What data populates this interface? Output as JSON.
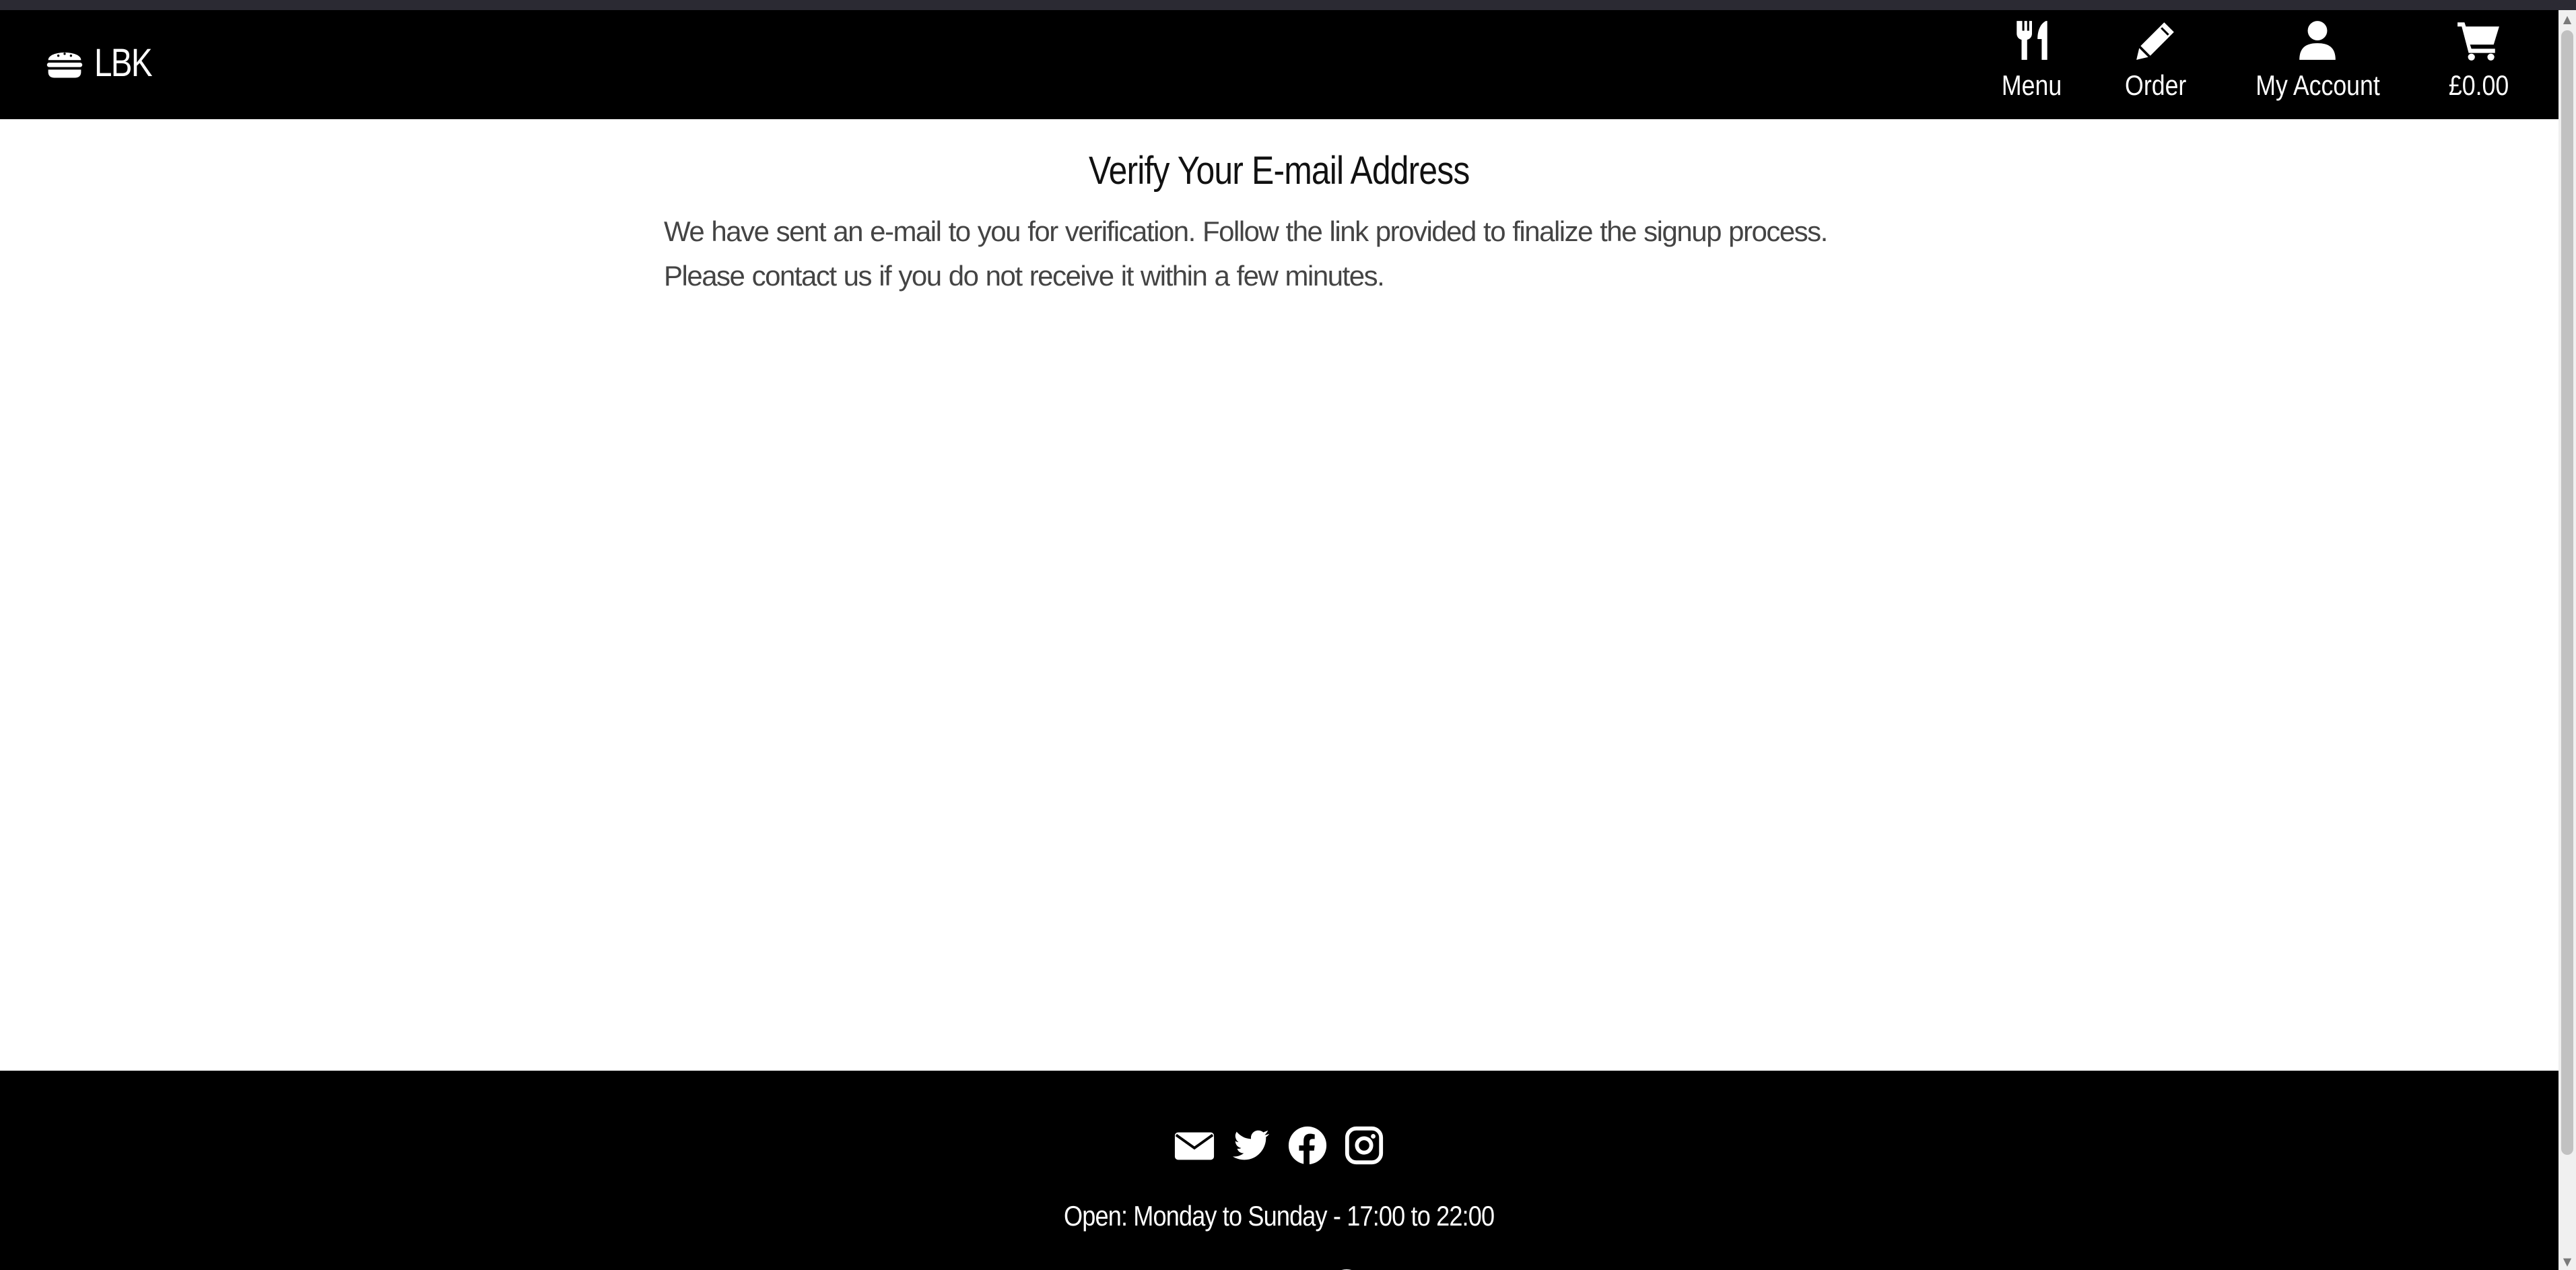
{
  "nav": {
    "brand": "LBK",
    "brand_icon": "burger-icon",
    "items": [
      {
        "label": "Menu",
        "icon": "utensils-icon"
      },
      {
        "label": "Order",
        "icon": "pencil-icon"
      },
      {
        "label": "My Account",
        "icon": "user-icon"
      },
      {
        "label": "£0.00",
        "icon": "cart-icon"
      }
    ]
  },
  "main": {
    "title": "Verify Your E-mail Address",
    "message": "We have sent an e-mail to you for verification. Follow the link provided to finalize the signup process. Please contact us if you do not receive it within a few minutes."
  },
  "footer": {
    "social_icons": [
      "envelope-icon",
      "twitter-icon",
      "facebook-icon",
      "instagram-icon"
    ],
    "hours": "Open: Monday to Sunday - 17:00 to 22:00"
  },
  "colors": {
    "nav_bg": "#000000",
    "footer_bg": "#000000",
    "text": "#444444",
    "heading": "#111111"
  }
}
